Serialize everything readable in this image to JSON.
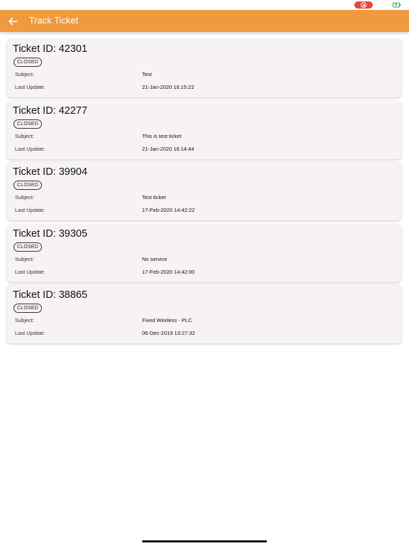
{
  "header": {
    "title": "Track Ticket"
  },
  "labels": {
    "subject": "Subject:",
    "last_update": "Last Update:"
  },
  "tickets": [
    {
      "id_label": "Ticket ID: 42301",
      "status": "CLOSED",
      "subject": "Test",
      "last_update": "21-Jan-2020 16:15:22"
    },
    {
      "id_label": "Ticket ID: 42277",
      "status": "CLOSED",
      "subject": "This is test ticket",
      "last_update": "21-Jan-2020 16:14:44"
    },
    {
      "id_label": "Ticket ID: 39904",
      "status": "CLOSED",
      "subject": "Test ticket",
      "last_update": "17-Feb-2020 14:42:22"
    },
    {
      "id_label": "Ticket ID: 39305",
      "status": "CLOSED",
      "subject": "No service",
      "last_update": "17-Feb-2020 14:42:00"
    },
    {
      "id_label": "Ticket ID: 38865",
      "status": "CLOSED",
      "subject": "Fixed Wireless - PLC",
      "last_update": "06-Dec-2019 13:27:32"
    }
  ],
  "colors": {
    "app_bar": "#ef9a3e",
    "card_background": "#f7f3f2",
    "record_indicator": "#e2483d",
    "battery": "#2fa84f"
  },
  "icons": {
    "back": "back-arrow-icon",
    "record": "screen-record-icon",
    "battery": "battery-icon"
  }
}
